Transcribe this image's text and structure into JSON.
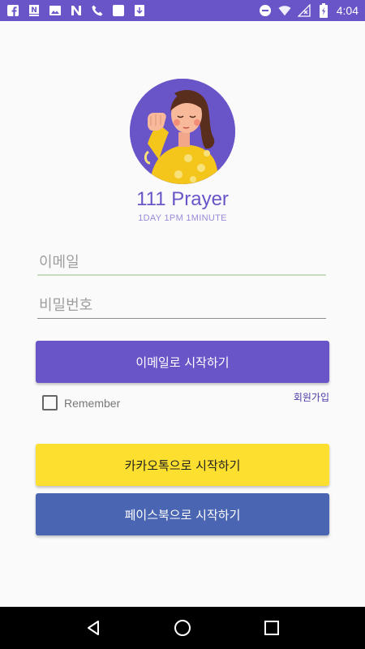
{
  "status_bar": {
    "time": "4:04",
    "left_icons": [
      "facebook-icon",
      "n-badge-icon",
      "image-icon",
      "n-logo-icon",
      "phone-icon",
      "square-icon",
      "download-icon"
    ],
    "right_icons": [
      "do-not-disturb-icon",
      "wifi-icon",
      "no-signal-icon",
      "battery-icon"
    ]
  },
  "header": {
    "title": "111 Prayer",
    "subtitle": "1DAY 1PM 1MINUTE"
  },
  "form": {
    "email_placeholder": "이메일",
    "password_placeholder": "비밀번호",
    "email_button": "이메일로 시작하기",
    "remember_label": "Remember",
    "signup_link": "회원가입"
  },
  "social": {
    "kakao_button": "카카오톡으로 시작하기",
    "facebook_button": "페이스북으로 시작하기"
  },
  "colors": {
    "primary": "#6a55c8",
    "kakao": "#fde02f",
    "facebook": "#4a66b3"
  }
}
